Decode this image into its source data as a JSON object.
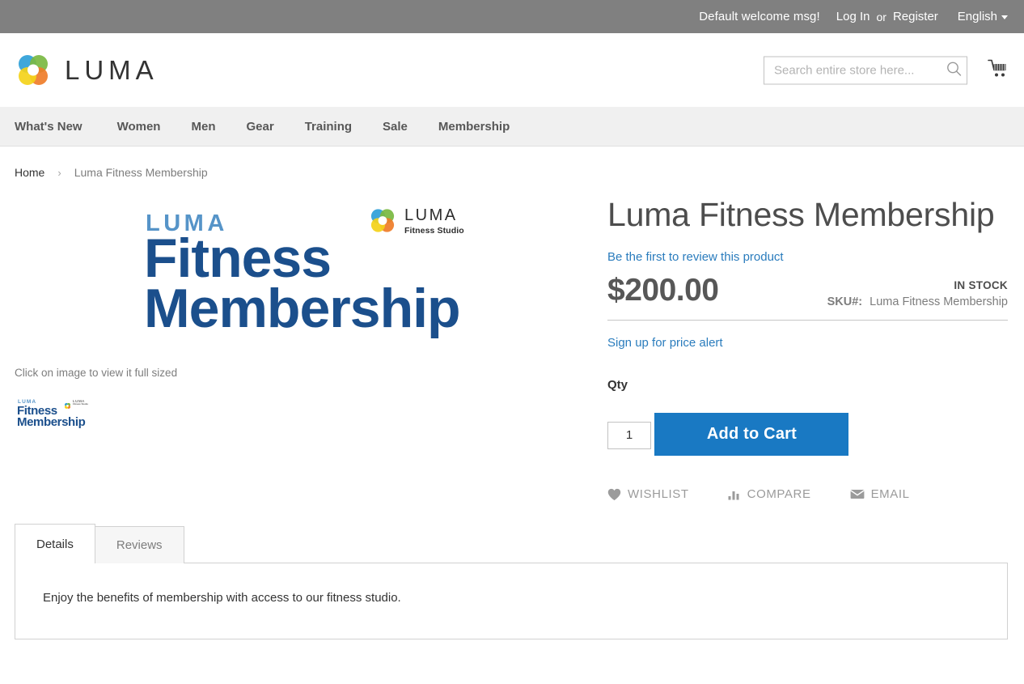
{
  "top_panel": {
    "welcome": "Default welcome msg!",
    "login_label": "Log In",
    "or_label": "or",
    "register_label": "Register",
    "language": "English"
  },
  "header": {
    "logo_text": "LUMA",
    "search": {
      "placeholder": "Search entire store here...",
      "value": "",
      "icon": "search-icon"
    },
    "cart_icon": "shopping-cart-icon"
  },
  "nav": {
    "items": [
      {
        "label": "What's New"
      },
      {
        "label": "Women"
      },
      {
        "label": "Men"
      },
      {
        "label": "Gear"
      },
      {
        "label": "Training"
      },
      {
        "label": "Sale"
      },
      {
        "label": "Membership"
      }
    ]
  },
  "breadcrumbs": {
    "home": "Home",
    "separator": "›",
    "current": "Luma Fitness Membership"
  },
  "product_image": {
    "brand_small": "LUMA",
    "line1": "Fitness",
    "line2": "Membership",
    "studio_name": "LUMA",
    "studio_sub": "Fitness Studio",
    "colors": {
      "brand_small": "#5694c8",
      "headline": "#1b4f8c"
    }
  },
  "media": {
    "click_note": "Click on image to view it full sized",
    "thumbnail_alt": "Luma Fitness Membership"
  },
  "product": {
    "title": "Luma Fitness Membership",
    "review_link": "Be the first to review this product",
    "price": "$200.00",
    "stock_status": "IN STOCK",
    "sku_label": "SKU#:",
    "sku_value": "Luma Fitness Membership",
    "price_alert": "Sign up for price alert",
    "qty_label": "Qty",
    "qty_value": "1",
    "add_to_cart_label": "Add to Cart",
    "actions": [
      {
        "label": "WISHLIST",
        "icon": "heart-icon"
      },
      {
        "label": "COMPARE",
        "icon": "compare-bars-icon"
      },
      {
        "label": "EMAIL",
        "icon": "envelope-icon"
      }
    ]
  },
  "tabs": {
    "items": [
      {
        "label": "Details",
        "active": true
      },
      {
        "label": "Reviews",
        "active": false
      }
    ],
    "details_content": "Enjoy the benefits of membership with access to our fitness studio."
  },
  "colors": {
    "top_panel_bg": "#808080",
    "nav_bg": "#f0f0f0",
    "accent_blue": "#1979c3",
    "link_blue": "#2a7cbd",
    "price_gray": "#575757"
  }
}
